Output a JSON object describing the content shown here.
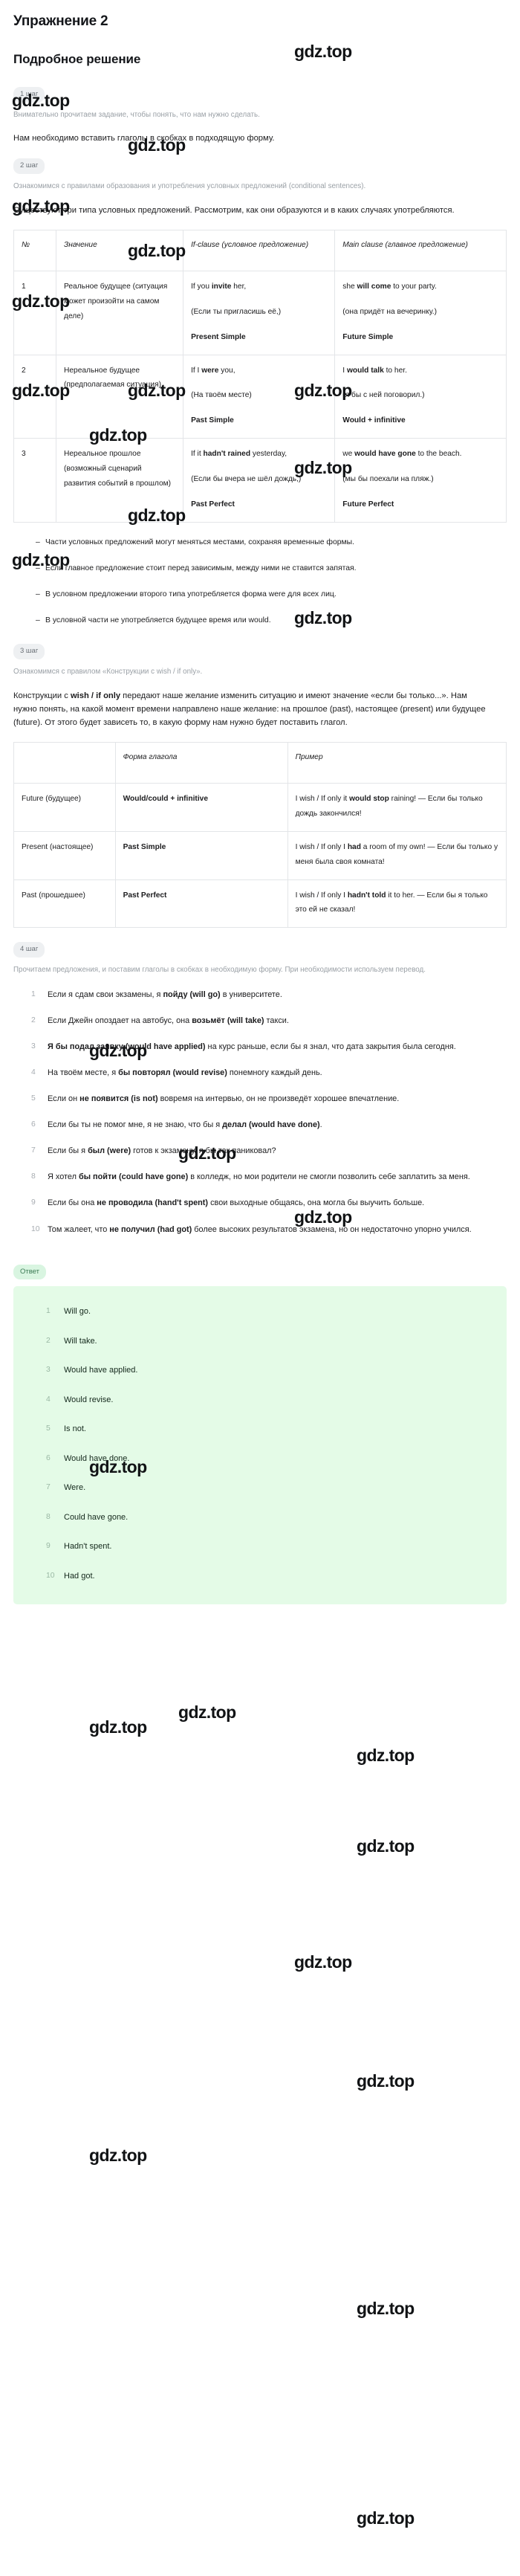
{
  "header": {
    "exercise_title": "Упражнение 2",
    "solution_title": "Подробное решение"
  },
  "watermark": {
    "text": "gdz.top"
  },
  "steps": {
    "step1": {
      "chip": "1 шаг",
      "note": "Внимательно прочитаем задание, чтобы понять, что нам нужно сделать.",
      "paragraph": "Нам необходимо вставить глаголы в скобках в подходящую форму."
    },
    "step2": {
      "chip": "2 шаг",
      "note": "Ознакомимся с правилами образования и употребления условных предложений (conditional sentences).",
      "intro_line1": "Существуют три типа условных предложений. Рассмотрим, как они",
      "intro_line2": "образуются и в каких случаях употребляются.",
      "table": {
        "headers": [
          "№",
          "Значение",
          "If-clause (условное предложение)",
          "Main clause (главное предложение)"
        ],
        "rows": [
          {
            "index": "1",
            "meaning": "Реальное будущее (ситуация может произойти на самом деле)",
            "if_clause_en_pre": "If you ",
            "if_clause_en_bold": "invite",
            "if_clause_en_post": " her,",
            "if_clause_ru": "(Если ты пригласишь её,)",
            "if_clause_form": "Present Simple",
            "main_clause_en_pre": "she ",
            "main_clause_en_bold": "will come",
            "main_clause_en_post": " to your party.",
            "main_clause_ru": "(она придёт на вечеринку.)",
            "main_clause_form": "Future Simple"
          },
          {
            "index": "2",
            "meaning": "Нереальное будущее (предполагаемая ситуация)",
            "if_clause_en_pre": "If I ",
            "if_clause_en_bold": "were",
            "if_clause_en_post": " you,",
            "if_clause_ru": "(На твоём месте)",
            "if_clause_form": "Past Simple",
            "main_clause_en_pre": "I ",
            "main_clause_en_bold": "would talk",
            "main_clause_en_post": " to her.",
            "main_clause_ru": "(я бы с ней поговорил.)",
            "main_clause_form": "Would + infinitive"
          },
          {
            "index": "3",
            "meaning": "Нереальное прошлое (возможный сценарий развития событий в прошлом)",
            "if_clause_en_pre": "If it ",
            "if_clause_en_bold": "hadn't rained",
            "if_clause_en_post": " yesterday,",
            "if_clause_ru": "(Если бы вчера не шёл дождь,)",
            "if_clause_form": "Past Perfect",
            "main_clause_en_pre": "we ",
            "main_clause_en_bold": "would have gone",
            "main_clause_en_post": " to the beach.",
            "main_clause_ru": "(мы бы поехали на пляж.)",
            "main_clause_form": "Future Perfect"
          }
        ]
      },
      "bullets": [
        "Части условных предложений могут меняться местами, сохраняя временные формы.",
        "Если главное предложение стоит перед зависимым, между ними не ставится запятая.",
        "В условном предложении второго типа употребляется форма were для всех лиц.",
        "В условной части не употребляется будущее время или would."
      ]
    },
    "step3": {
      "chip": "3 шаг",
      "note": "Ознакомимся с правилом «Конструкции с wish / if only».",
      "paragraph_pre": "Конструкции с ",
      "paragraph_bold1": "wish / if only",
      "paragraph_mid": " передают наше желание изменить ситуацию и имеют значение «если бы только...». Нам нужно понять, на какой момент времени направлено наше желание: на прошлое (past), настоящее (present) или будущее (future). От этого будет зависеть то, в какую форму нам нужно будет поставить глагол.",
      "table": {
        "headers": [
          "",
          "Форма глагола",
          "Пример"
        ],
        "rows": [
          {
            "time": "Future (будущее)",
            "form": "Would/could + infinitive",
            "example_pre": "I wish / If only it ",
            "example_bold": "would stop",
            "example_post": " raining! — Если бы только дождь закончился!"
          },
          {
            "time": "Present (настоящее)",
            "form": "Past Simple",
            "example_pre": "I wish / If only I ",
            "example_bold": "had",
            "example_post": " a room of my own! — Если бы только у меня была своя комната!"
          },
          {
            "time": "Past (прошедшее)",
            "form": "Past Perfect",
            "example_pre": "I wish / If only I ",
            "example_bold": "hadn't told",
            "example_post": " it to her. — Если бы я только это ей не сказал!"
          }
        ]
      }
    },
    "step4": {
      "chip": "4 шаг",
      "note": "Прочитаем предложения, и поставим глаголы в скобках в необходимую форму. При необходимости используем перевод.",
      "tasks": [
        {
          "pre": "Если я сдам свои экзамены, я ",
          "bold": "пойду (will go)",
          "post": " в университете."
        },
        {
          "pre": "Если Джейн опоздает на автобус, она ",
          "bold": "возьмёт (will take)",
          "post": " такси."
        },
        {
          "pre": "",
          "bold": "Я бы подал заявку (would have applied)",
          "post": " на курс раньше, если бы я знал, что дата закрытия была сегодня."
        },
        {
          "pre": "На твоём месте, я ",
          "bold": "бы повторял (would revise)",
          "post": " понемногу каждый день."
        },
        {
          "pre": "Если он ",
          "bold": "не появится (is not)",
          "post": " вовремя на интервью, он не произведёт хорошее впечатление."
        },
        {
          "pre": "Если бы ты не помог мне, я не знаю, что бы я ",
          "bold": "делал (would have done)",
          "post": "."
        },
        {
          "pre": "Если бы я ",
          "bold": "был (were)",
          "post": " готов к экзамену, я бы так паниковал?"
        },
        {
          "pre": "Я хотел ",
          "bold": "бы пойти (could have gone)",
          "post": " в колледж, но мои родители не смогли позволить себе заплатить за меня."
        },
        {
          "pre": "Если бы она ",
          "bold": "не проводила (hand't spent)",
          "post": " свои выходные общаясь, она могла бы выучить больше."
        },
        {
          "pre": "Том жалеет, что ",
          "bold": "не получил (had got)",
          "post": " более высоких результатов экзамена, но он недостаточно упорно учился."
        }
      ]
    }
  },
  "answer": {
    "chip": "Ответ",
    "items": [
      "Will go.",
      "Will take.",
      "Would have applied.",
      "Would revise.",
      "Is not.",
      "Would have done.",
      "Were.",
      "Could have gone.",
      "Hadn't spent.",
      "Had got."
    ]
  }
}
